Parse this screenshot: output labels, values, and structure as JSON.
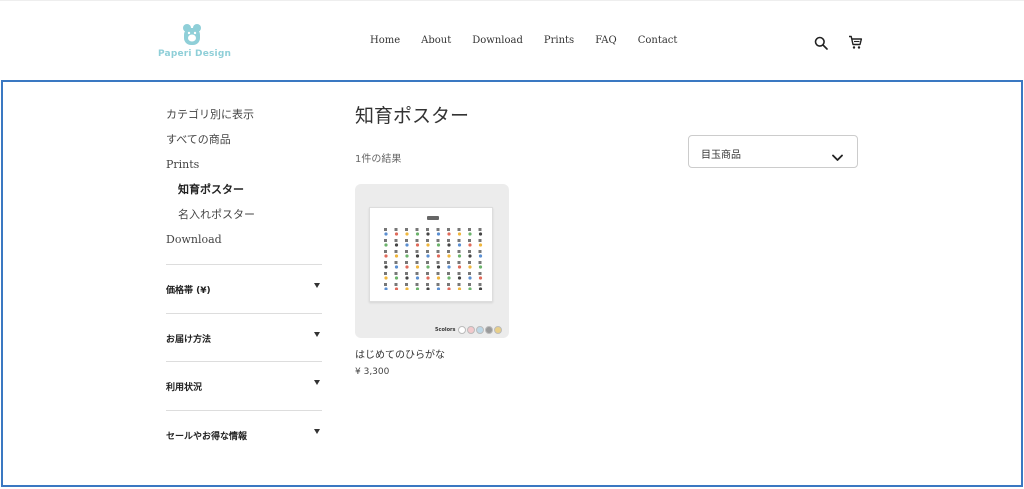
{
  "header": {
    "logo_text": "Paperi Design",
    "nav": [
      "Home",
      "About",
      "Download",
      "Prints",
      "FAQ",
      "Contact"
    ]
  },
  "sidebar": {
    "heading": "カテゴリ別に表示",
    "items": [
      {
        "label": "すべての商品",
        "sub": false,
        "active": false
      },
      {
        "label": "Prints",
        "sub": false,
        "active": false
      },
      {
        "label": "知育ポスター",
        "sub": true,
        "active": true
      },
      {
        "label": "名入れポスター",
        "sub": true,
        "active": false
      },
      {
        "label": "Download",
        "sub": false,
        "active": false
      }
    ],
    "filters": [
      "価格帯 (¥)",
      "お届け方法",
      "利用状況",
      "セールやお得な情報"
    ]
  },
  "main": {
    "title": "知育ポスター",
    "results": "1件の結果",
    "sort": {
      "value": "目玉商品"
    }
  },
  "product": {
    "name": "はじめてのひらがな",
    "price": "¥ 3,300",
    "swatch_label": "5colors",
    "swatch_colors": [
      "#ffffff",
      "#f2c9cc",
      "#bcd7e6",
      "#9a9a9a",
      "#e8cf8a"
    ]
  },
  "colors": {
    "accent_frame": "#3a78c2",
    "logo": "#8fcfd8"
  }
}
